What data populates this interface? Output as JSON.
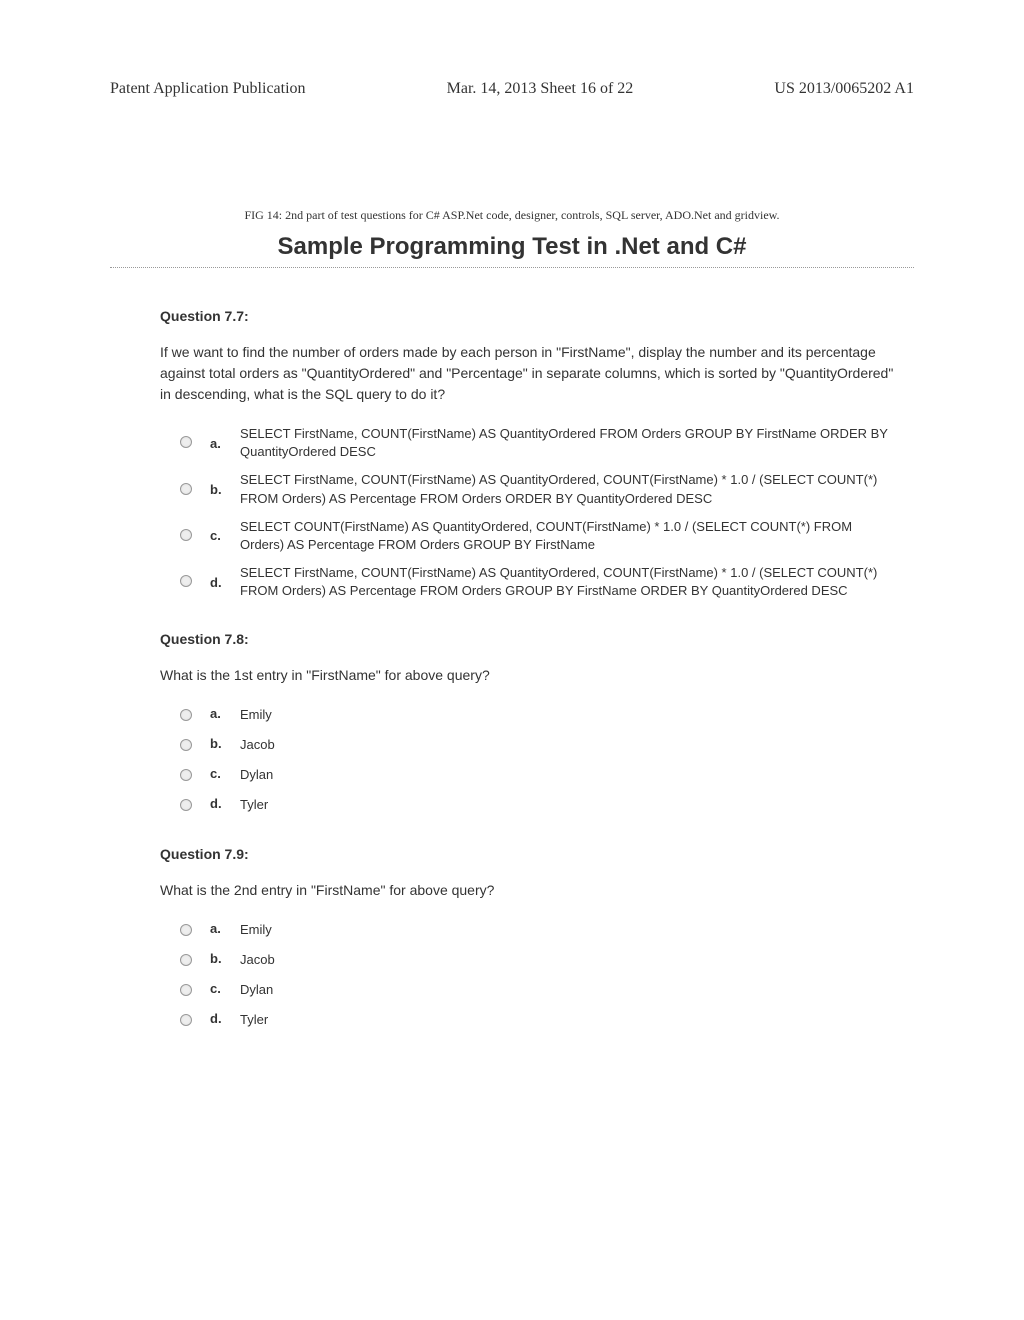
{
  "header": {
    "left": "Patent Application Publication",
    "center": "Mar. 14, 2013  Sheet 16 of 22",
    "right": "US 2013/0065202 A1"
  },
  "fig_caption": "FIG 14: 2nd part of test questions for C# ASP.Net code, designer, controls, SQL server, ADO.Net and gridview.",
  "main_title": "Sample Programming Test in .Net and C#",
  "questions": [
    {
      "title": "Question 7.7:",
      "prompt": "If we want to find the number of orders made by each person in \"FirstName\", display the number and its percentage against total orders as \"QuantityOrdered\" and \"Percentage\" in separate columns, which is sorted by \"QuantityOrdered\" in descending,  what is the SQL query to do it?",
      "answers": [
        {
          "letter": "a.",
          "text": "SELECT FirstName, COUNT(FirstName) AS QuantityOrdered FROM Orders GROUP BY FirstName ORDER BY QuantityOrdered DESC"
        },
        {
          "letter": "b.",
          "text": "SELECT FirstName, COUNT(FirstName) AS QuantityOrdered, COUNT(FirstName) * 1.0 / (SELECT COUNT(*) FROM Orders) AS Percentage FROM Orders ORDER BY QuantityOrdered DESC"
        },
        {
          "letter": "c.",
          "text": "SELECT COUNT(FirstName) AS QuantityOrdered, COUNT(FirstName) * 1.0 / (SELECT COUNT(*) FROM Orders) AS Percentage FROM Orders GROUP BY FirstName"
        },
        {
          "letter": "d.",
          "text": "SELECT FirstName, COUNT(FirstName) AS QuantityOrdered, COUNT(FirstName) * 1.0 / (SELECT COUNT(*) FROM Orders) AS Percentage FROM Orders GROUP BY FirstName ORDER BY QuantityOrdered DESC"
        }
      ],
      "multiline": true
    },
    {
      "title": "Question 7.8:",
      "prompt": "What is the 1st entry in \"FirstName\" for above query?",
      "answers": [
        {
          "letter": "a.",
          "text": "Emily"
        },
        {
          "letter": "b.",
          "text": "Jacob"
        },
        {
          "letter": "c.",
          "text": "Dylan"
        },
        {
          "letter": "d.",
          "text": "Tyler"
        }
      ],
      "multiline": false
    },
    {
      "title": "Question 7.9:",
      "prompt": "What is the 2nd entry in \"FirstName\" for above query?",
      "answers": [
        {
          "letter": "a.",
          "text": "Emily"
        },
        {
          "letter": "b.",
          "text": "Jacob"
        },
        {
          "letter": "c.",
          "text": "Dylan"
        },
        {
          "letter": "d.",
          "text": "Tyler"
        }
      ],
      "multiline": false
    }
  ]
}
